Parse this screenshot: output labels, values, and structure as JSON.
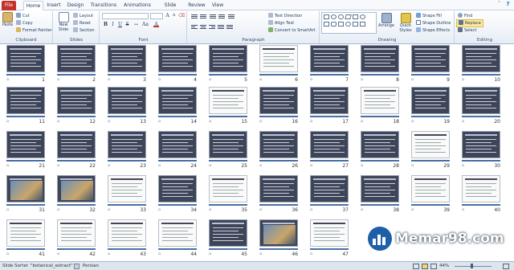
{
  "tabs": [
    "File",
    "Home",
    "Insert",
    "Design",
    "Transitions",
    "Animations",
    "Slide Show",
    "Review",
    "View"
  ],
  "ribbon": {
    "clipboard": {
      "label": "Clipboard",
      "paste": "Paste",
      "cut": "Cut",
      "copy": "Copy",
      "format_painter": "Format Painter"
    },
    "slides": {
      "label": "Slides",
      "new_slide": "New Slide",
      "layout": "Layout",
      "reset": "Reset",
      "section": "Section"
    },
    "font": {
      "label": "Font",
      "bold": "B",
      "italic": "I",
      "underline": "U",
      "strike": "S",
      "font_size_up": "A",
      "font_size_down": "A"
    },
    "paragraph": {
      "label": "Paragraph",
      "text_direction": "Text Direction",
      "align_text": "Align Text",
      "convert_smartart": "Convert to SmartArt"
    },
    "drawing": {
      "label": "Drawing",
      "arrange": "Arrange",
      "quick_styles": "Quick Styles",
      "shape_fill": "Shape Fill",
      "shape_outline": "Shape Outline",
      "shape_effects": "Shape Effects"
    },
    "editing": {
      "label": "Editing",
      "find": "Find",
      "replace": "Replace",
      "select": "Select"
    }
  },
  "slides": [
    {
      "n": "1",
      "theme": "dark"
    },
    {
      "n": "2",
      "theme": "dark"
    },
    {
      "n": "3",
      "theme": "dark"
    },
    {
      "n": "4",
      "theme": "dark"
    },
    {
      "n": "5",
      "theme": "dark"
    },
    {
      "n": "6",
      "theme": "white"
    },
    {
      "n": "7",
      "theme": "dark"
    },
    {
      "n": "8",
      "theme": "dark"
    },
    {
      "n": "9",
      "theme": "dark"
    },
    {
      "n": "10",
      "theme": "dark"
    },
    {
      "n": "11",
      "theme": "dark"
    },
    {
      "n": "12",
      "theme": "dark"
    },
    {
      "n": "13",
      "theme": "dark"
    },
    {
      "n": "14",
      "theme": "dark"
    },
    {
      "n": "15",
      "theme": "white"
    },
    {
      "n": "16",
      "theme": "dark"
    },
    {
      "n": "17",
      "theme": "dark"
    },
    {
      "n": "18",
      "theme": "white"
    },
    {
      "n": "19",
      "theme": "dark"
    },
    {
      "n": "20",
      "theme": "dark"
    },
    {
      "n": "21",
      "theme": "dark"
    },
    {
      "n": "22",
      "theme": "dark"
    },
    {
      "n": "23",
      "theme": "dark"
    },
    {
      "n": "24",
      "theme": "dark"
    },
    {
      "n": "25",
      "theme": "dark"
    },
    {
      "n": "26",
      "theme": "dark"
    },
    {
      "n": "27",
      "theme": "dark"
    },
    {
      "n": "28",
      "theme": "dark"
    },
    {
      "n": "29",
      "theme": "white"
    },
    {
      "n": "30",
      "theme": "dark"
    },
    {
      "n": "31",
      "theme": "photo"
    },
    {
      "n": "32",
      "theme": "photo"
    },
    {
      "n": "33",
      "theme": "white"
    },
    {
      "n": "34",
      "theme": "dark"
    },
    {
      "n": "35",
      "theme": "white"
    },
    {
      "n": "36",
      "theme": "dark"
    },
    {
      "n": "37",
      "theme": "dark"
    },
    {
      "n": "38",
      "theme": "dark"
    },
    {
      "n": "39",
      "theme": "white"
    },
    {
      "n": "40",
      "theme": "white"
    },
    {
      "n": "41",
      "theme": "white"
    },
    {
      "n": "42",
      "theme": "white"
    },
    {
      "n": "43",
      "theme": "white"
    },
    {
      "n": "44",
      "theme": "white"
    },
    {
      "n": "45",
      "theme": "dark"
    },
    {
      "n": "46",
      "theme": "photo"
    },
    {
      "n": "47",
      "theme": "white"
    }
  ],
  "watermark": {
    "text": "Memar98.com"
  },
  "statusbar": {
    "view": "Slide Sorter",
    "theme": "\"botanical_extract\"",
    "language": "Persian",
    "zoom": "44%"
  },
  "colors": {
    "accent": "#c4302b",
    "ribbon_text": "#1e395b",
    "slide_dark": "#3f4559",
    "brand_blue": "#1d5fa8"
  }
}
